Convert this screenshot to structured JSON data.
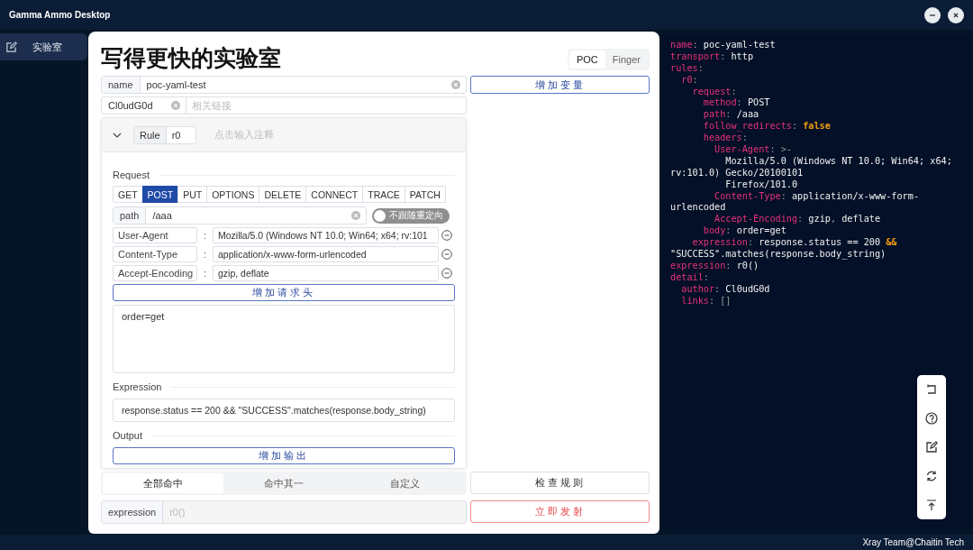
{
  "window": {
    "title": "Gamma Ammo Desktop"
  },
  "sidebar": {
    "items": [
      {
        "label": "实验室",
        "selected": true
      }
    ]
  },
  "editor": {
    "title": "写得更快的实验室",
    "mode_tabs": [
      {
        "label": "POC",
        "selected": true
      },
      {
        "label": "Finger",
        "selected": false
      }
    ],
    "name_field": {
      "label": "name",
      "value": "poc-yaml-test"
    },
    "add_variable_button": "增加变量",
    "author_field": {
      "value": "Cl0udG0d"
    },
    "links_field": {
      "placeholder": "相关链接"
    },
    "rule": {
      "expanded": true,
      "label": "Rule",
      "id": "r0",
      "comment_placeholder": "点击输入注释",
      "request_label": "Request",
      "methods": [
        {
          "label": "GET",
          "selected": false
        },
        {
          "label": "POST",
          "selected": true
        },
        {
          "label": "PUT",
          "selected": false
        },
        {
          "label": "OPTIONS",
          "selected": false
        },
        {
          "label": "DELETE",
          "selected": false
        },
        {
          "label": "CONNECT",
          "selected": false
        },
        {
          "label": "TRACE",
          "selected": false
        },
        {
          "label": "PATCH",
          "selected": false
        }
      ],
      "path": {
        "label": "path",
        "value": "/aaa"
      },
      "follow_redirects": {
        "label": "不跟随重定向",
        "on": false
      },
      "headers": [
        {
          "key": "User-Agent",
          "separator": ":",
          "value": "Mozilla/5.0 (Windows NT 10.0; Win64; x64; rv:101"
        },
        {
          "key": "Content-Type",
          "separator": ":",
          "value": "application/x-www-form-urlencoded"
        },
        {
          "key": "Accept-Encoding",
          "separator": ":",
          "value": "gzip, deflate"
        }
      ],
      "add_header_button": "增加请求头",
      "body": "order=get",
      "expression_label": "Expression",
      "expression": "response.status == 200 && \"SUCCESS\".matches(response.body_string)",
      "output_label": "Output",
      "add_output_button": "增加输出"
    },
    "match_modes": [
      {
        "label": "全部命中",
        "selected": true
      },
      {
        "label": "命中其一",
        "selected": false
      },
      {
        "label": "自定义",
        "selected": false
      }
    ],
    "check_button": "检查规则",
    "expression_field": {
      "label": "expression",
      "placeholder": "r0()",
      "disabled": true
    },
    "fire_button": "立即发射"
  },
  "code_lines": [
    [
      {
        "kind": "key",
        "text": "name"
      },
      {
        "kind": "punct",
        "text": ": "
      },
      {
        "kind": "value",
        "text": "poc-yaml-test"
      }
    ],
    [
      {
        "kind": "key",
        "text": "transport"
      },
      {
        "kind": "punct",
        "text": ": "
      },
      {
        "kind": "value",
        "text": "http"
      }
    ],
    [
      {
        "kind": "key",
        "text": "rules"
      },
      {
        "kind": "punct",
        "text": ":"
      }
    ],
    [
      {
        "kind": "key",
        "text": "  r0"
      },
      {
        "kind": "punct",
        "text": ":"
      }
    ],
    [
      {
        "kind": "key",
        "text": "    request"
      },
      {
        "kind": "punct",
        "text": ":"
      }
    ],
    [
      {
        "kind": "key",
        "text": "      method"
      },
      {
        "kind": "punct",
        "text": ": "
      },
      {
        "kind": "value",
        "text": "POST"
      }
    ],
    [
      {
        "kind": "key",
        "text": "      path"
      },
      {
        "kind": "punct",
        "text": ": "
      },
      {
        "kind": "value",
        "text": "/aaa"
      }
    ],
    [
      {
        "kind": "key",
        "text": "      follow_redirects"
      },
      {
        "kind": "punct",
        "text": ": "
      },
      {
        "kind": "literal",
        "text": "false"
      }
    ],
    [
      {
        "kind": "key",
        "text": "      headers"
      },
      {
        "kind": "punct",
        "text": ":"
      }
    ],
    [
      {
        "kind": "key",
        "text": "        User-Agent"
      },
      {
        "kind": "punct",
        "text": ": >-"
      }
    ],
    [
      {
        "kind": "value",
        "text": "          Mozilla/5.0 (Windows NT 10.0; Win64; x64;"
      }
    ],
    [
      {
        "kind": "value",
        "text": "rv:101.0) Gecko/20100101"
      }
    ],
    [
      {
        "kind": "value",
        "text": "          Firefox/101.0"
      }
    ],
    [
      {
        "kind": "key",
        "text": "        Content-Type"
      },
      {
        "kind": "punct",
        "text": ": "
      },
      {
        "kind": "value",
        "text": "application/x-www-form-"
      }
    ],
    [
      {
        "kind": "value",
        "text": "urlencoded"
      }
    ],
    [
      {
        "kind": "key",
        "text": "        Accept-Encoding"
      },
      {
        "kind": "punct",
        "text": ": "
      },
      {
        "kind": "value",
        "text": "gzip"
      },
      {
        "kind": "punct",
        "text": ", "
      },
      {
        "kind": "value",
        "text": "deflate"
      }
    ],
    [
      {
        "kind": "key",
        "text": "      body"
      },
      {
        "kind": "punct",
        "text": ": "
      },
      {
        "kind": "value",
        "text": "order=get"
      }
    ],
    [
      {
        "kind": "key",
        "text": "    expression"
      },
      {
        "kind": "punct",
        "text": ": "
      },
      {
        "kind": "value",
        "text": "response.status == 200 "
      },
      {
        "kind": "literal",
        "text": "&&"
      }
    ],
    [
      {
        "kind": "value",
        "text": "\"SUCCESS\".matches(response.body_string)"
      }
    ],
    [
      {
        "kind": "key",
        "text": "expression"
      },
      {
        "kind": "punct",
        "text": ": "
      },
      {
        "kind": "value",
        "text": "r0()"
      }
    ],
    [
      {
        "kind": "key",
        "text": "detail"
      },
      {
        "kind": "punct",
        "text": ":"
      }
    ],
    [
      {
        "kind": "key",
        "text": "  author"
      },
      {
        "kind": "punct",
        "text": ": "
      },
      {
        "kind": "value",
        "text": "Cl0udG0d"
      }
    ],
    [
      {
        "kind": "key",
        "text": "  links"
      },
      {
        "kind": "punct",
        "text": ": "
      },
      {
        "kind": "punct",
        "text": "[]"
      }
    ]
  ],
  "status_bar": {
    "text": "Xray Team@Chaitin Tech"
  }
}
